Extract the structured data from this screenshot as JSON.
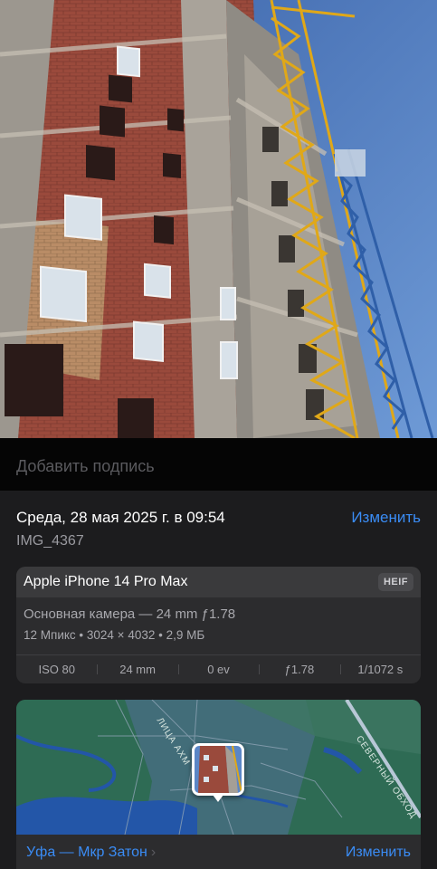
{
  "caption": {
    "placeholder": "Добавить подпись"
  },
  "info": {
    "date": "Среда, 28 мая 2025 г. в 09:54",
    "edit_label": "Изменить",
    "filename": "IMG_4367"
  },
  "exif": {
    "device": "Apple iPhone 14 Pro Max",
    "format": "HEIF",
    "lens": "Основная камера — 24 mm ƒ1.78",
    "specs": "12 Мпикс • 3024 × 4032 • 2,9 МБ",
    "params": [
      "ISO 80",
      "24 mm",
      "0 ev",
      "ƒ1.78",
      "1/1072 s"
    ]
  },
  "map": {
    "streets": [
      "ЛИЦА АХМ",
      "СЕВЕРНЫЙ ОБХОД"
    ],
    "location": "Уфа — Мкр Затон",
    "chevron_icon": "chevron-right-icon",
    "edit_label": "Изменить"
  },
  "colors": {
    "accent": "#3a8cf5",
    "panel": "#1c1c1e",
    "card": "#2c2c2e"
  }
}
